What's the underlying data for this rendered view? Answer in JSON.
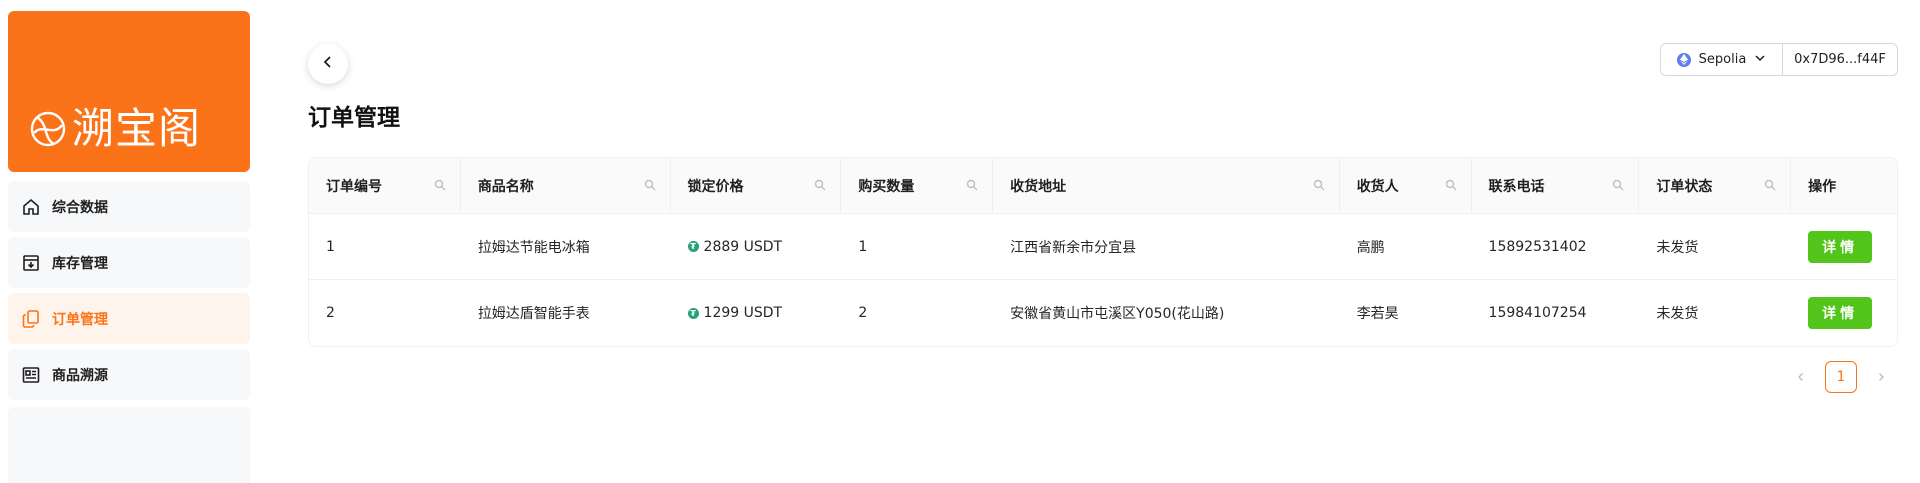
{
  "brand": {
    "name": "溯宝阁",
    "color": "#fb7318",
    "icon": "globe-icon"
  },
  "sidebar": {
    "items": [
      {
        "label": "综合数据",
        "icon": "home-icon",
        "active": false
      },
      {
        "label": "库存管理",
        "icon": "inbox-icon",
        "active": false
      },
      {
        "label": "订单管理",
        "icon": "copy-icon",
        "active": true
      },
      {
        "label": "商品溯源",
        "icon": "newspaper-icon",
        "active": false
      }
    ]
  },
  "header": {
    "title": "订单管理",
    "back_icon": "chevron-left-icon"
  },
  "wallet": {
    "network": "Sepolia",
    "network_icon": "ethereum-icon",
    "address": "0x7D96...f44F"
  },
  "table": {
    "columns": [
      {
        "label": "订单编号",
        "searchable": true
      },
      {
        "label": "商品名称",
        "searchable": true
      },
      {
        "label": "锁定价格",
        "searchable": true
      },
      {
        "label": "购买数量",
        "searchable": true
      },
      {
        "label": "收货地址",
        "searchable": true
      },
      {
        "label": "收货人",
        "searchable": true
      },
      {
        "label": "联系电话",
        "searchable": true
      },
      {
        "label": "订单状态",
        "searchable": true
      },
      {
        "label": "操作",
        "searchable": false
      }
    ],
    "rows": [
      {
        "id": "1",
        "product": "拉姆达节能电冰箱",
        "price": "2889 USDT",
        "qty": "1",
        "address": "江西省新余市分宜县",
        "receiver": "高鹏",
        "phone": "15892531402",
        "status": "未发货",
        "action": "详情"
      },
      {
        "id": "2",
        "product": "拉姆达盾智能手表",
        "price": "1299 USDT",
        "qty": "2",
        "address": "安徽省黄山市屯溪区Y050(花山路)",
        "receiver": "李若昊",
        "phone": "15984107254",
        "status": "未发货",
        "action": "详情"
      }
    ]
  },
  "pagination": {
    "current": "1"
  },
  "colors": {
    "accent": "#fb7318",
    "success": "#52c41a",
    "usdt": "#26a17b"
  }
}
